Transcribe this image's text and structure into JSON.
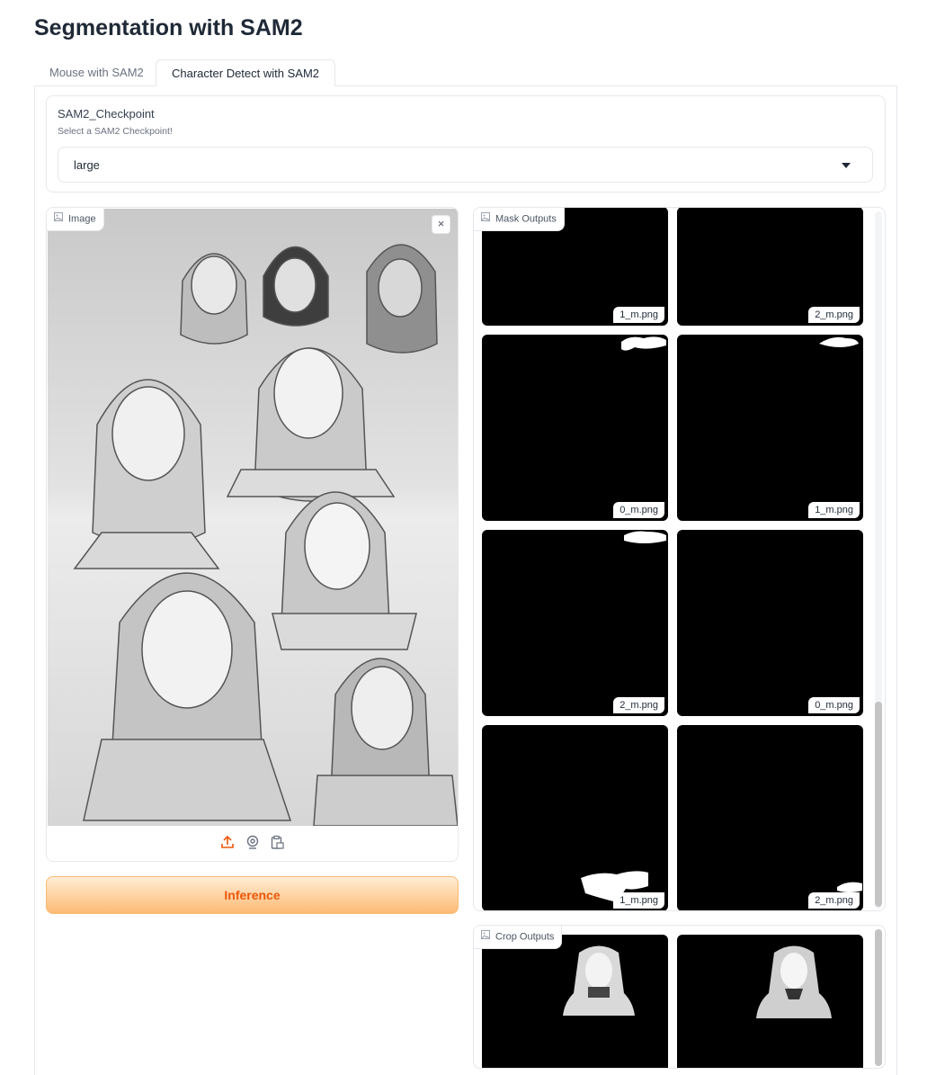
{
  "page": {
    "title": "Segmentation with SAM2"
  },
  "tabs": [
    {
      "label": "Mouse with SAM2",
      "active": false
    },
    {
      "label": "Character Detect with SAM2",
      "active": true
    }
  ],
  "checkpoint": {
    "label": "SAM2_Checkpoint",
    "info": "Select a SAM2 Checkpoint!",
    "value": "large"
  },
  "image_input": {
    "label": "Image",
    "tools": [
      "upload-icon",
      "webcam-icon",
      "clipboard-icon"
    ]
  },
  "inference_button": {
    "label": "Inference"
  },
  "mask_outputs": {
    "label": "Mask Outputs",
    "items": [
      {
        "caption": "1_m.png"
      },
      {
        "caption": "2_m.png"
      },
      {
        "caption": "0_m.png"
      },
      {
        "caption": "1_m.png"
      },
      {
        "caption": "2_m.png"
      },
      {
        "caption": "0_m.png"
      },
      {
        "caption": "1_m.png"
      },
      {
        "caption": "2_m.png"
      }
    ]
  },
  "crop_outputs": {
    "label": "Crop Outputs"
  },
  "colors": {
    "accent": "#ea580c",
    "button_gradient_top": "#ffedd5",
    "button_gradient_bottom": "#fdba74",
    "border": "#e5e7eb"
  }
}
